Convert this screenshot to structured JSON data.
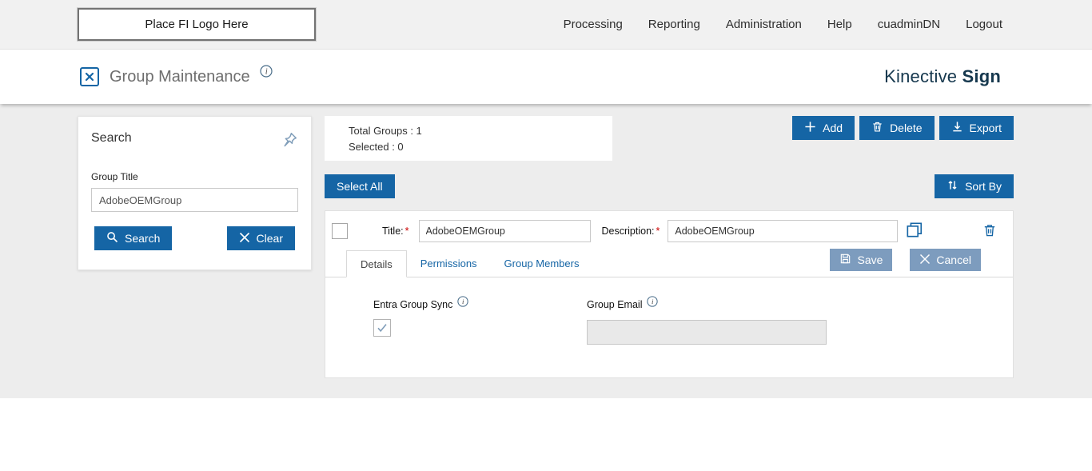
{
  "colors": {
    "primary_blue": "#1565a5",
    "muted_button_blue": "#7d9cbe",
    "brand_navy": "#16384e",
    "required_red": "#cc0000",
    "topbar_bg": "#f1f1f1",
    "content_bg": "#ededed"
  },
  "header": {
    "logo_placeholder": "Place FI Logo Here",
    "nav": [
      "Processing",
      "Reporting",
      "Administration",
      "Help",
      "cuadminDN",
      "Logout"
    ]
  },
  "page": {
    "title": "Group Maintenance",
    "brand_name": "Kinective",
    "brand_suffix": "Sign"
  },
  "search_panel": {
    "title": "Search",
    "group_title_label": "Group Title",
    "group_title_value": "AdobeOEMGroup",
    "search_button": "Search",
    "clear_button": "Clear"
  },
  "summary": {
    "total_groups": "Total Groups : 1",
    "selected": "Selected : 0"
  },
  "toolbar": {
    "add": "Add",
    "delete": "Delete",
    "export": "Export",
    "select_all": "Select All",
    "sort_by": "Sort By"
  },
  "group_editor": {
    "title_label": "Title:",
    "required_marker": "*",
    "title_value": "AdobeOEMGroup",
    "description_label": "Description:",
    "description_value": "AdobeOEMGroup",
    "tabs": [
      "Details",
      "Permissions",
      "Group Members"
    ],
    "save": "Save",
    "cancel": "Cancel",
    "entra_label": "Entra Group Sync",
    "group_email_label": "Group Email",
    "entra_checked": true,
    "group_email_value": ""
  }
}
